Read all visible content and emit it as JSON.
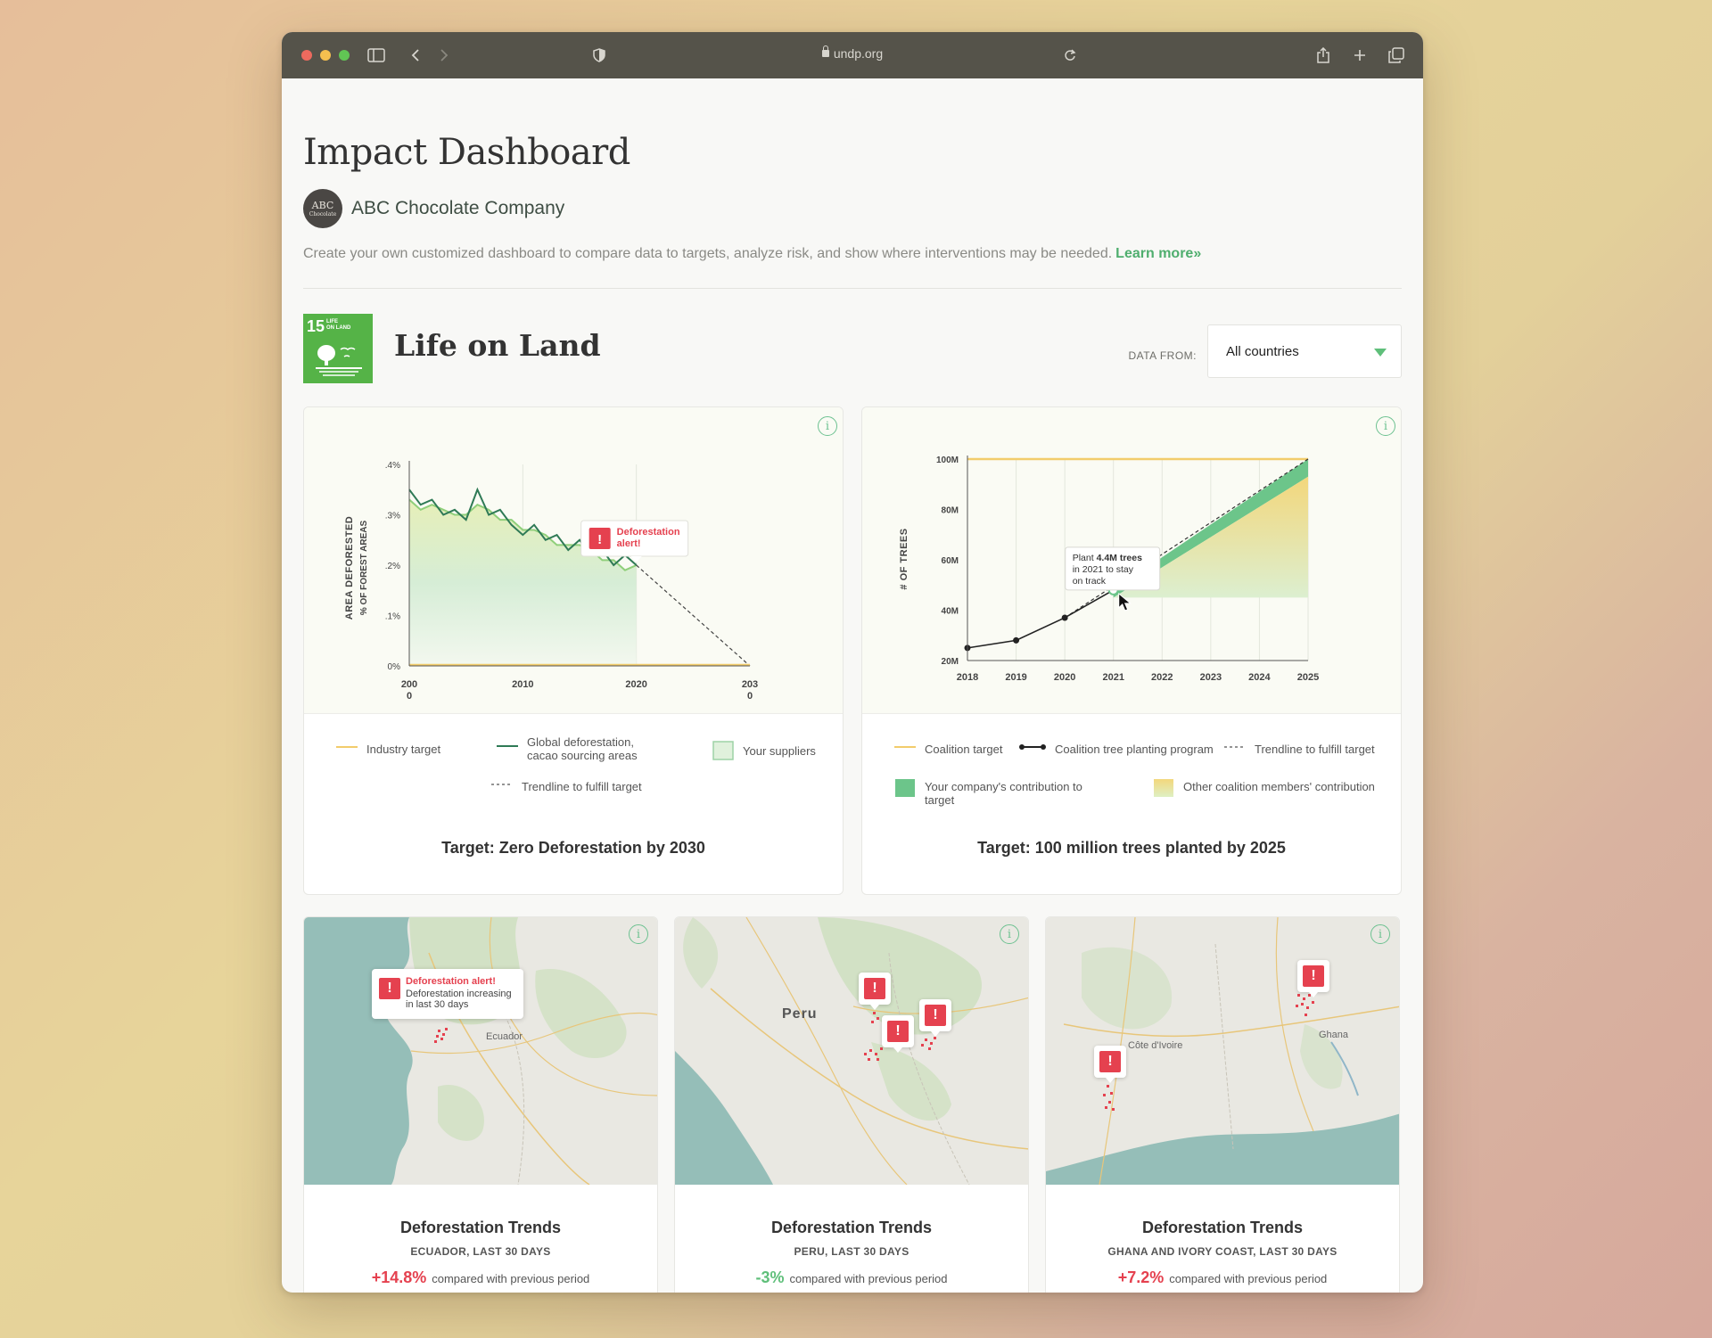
{
  "browser": {
    "url": "undp.org"
  },
  "header": {
    "title": "Impact Dashboard",
    "company_logo_line1": "ABC",
    "company_logo_line2": "Chocolate",
    "company_name": "ABC Chocolate Company",
    "description": "Create your own customized dashboard to compare data to targets, analyze risk, and show where interventions may be needed.",
    "learn_more": "Learn more»"
  },
  "section": {
    "sdg_number": "15",
    "sdg_label_line1": "LIFE",
    "sdg_label_line2": "ON LAND",
    "title": "Life on Land",
    "data_from_label": "DATA FROM:",
    "data_from_value": "All countries"
  },
  "colors": {
    "accent_green": "#4fae6e",
    "alert_red": "#e5414f",
    "target_yellow": "#f2cc6b",
    "dark_green": "#2f7a56",
    "light_green": "#8fcf7a"
  },
  "chart1": {
    "target": "Target: Zero Deforestation by 2030",
    "ylabel_line1": "AREA DEFORESTED",
    "ylabel_line2": "% OF FOREST AREAS",
    "alert_line1": "Deforestation",
    "alert_line2": "alert!",
    "tick_2000_a": "200",
    "tick_2000_b": "0",
    "tick_2030_a": "203",
    "tick_2030_b": "0",
    "legend": {
      "industry": "Industry target",
      "global_line1": "Global deforestation,",
      "global_line2": "cacao sourcing areas",
      "suppliers": "Your suppliers",
      "trendline": "Trendline to fulfill target"
    }
  },
  "chart2": {
    "target": "Target: 100 million trees planted by 2025",
    "ylabel": "# OF TREES",
    "tooltip_pre": "Plant ",
    "tooltip_bold": "4.4M trees",
    "tooltip_line2": "in 2021 to stay",
    "tooltip_line3": "on track",
    "legend": {
      "coalition_target": "Coalition target",
      "program": "Coalition tree planting program",
      "trendline": "Trendline to fulfill target",
      "company_line1": "Your company's contribution to",
      "company_line2": "target",
      "others": "Other coalition members' contribution"
    }
  },
  "chart_data": [
    {
      "type": "line",
      "title": "",
      "ylabel": "AREA DEFORESTED % OF FOREST AREAS",
      "x_range": [
        2000,
        2030
      ],
      "ylim": [
        0,
        0.4
      ],
      "yticks": [
        ".4%",
        ".3%",
        ".2%",
        ".1%",
        "0%"
      ],
      "xticks": [
        "2010",
        "2020"
      ],
      "series": [
        {
          "name": "Global deforestation, cacao sourcing areas",
          "x": [
            2000,
            2001,
            2002,
            2003,
            2004,
            2005,
            2006,
            2007,
            2008,
            2009,
            2010,
            2011,
            2012,
            2013,
            2014,
            2015,
            2016,
            2017,
            2018,
            2019,
            2020
          ],
          "values": [
            0.35,
            0.32,
            0.33,
            0.3,
            0.31,
            0.29,
            0.35,
            0.3,
            0.31,
            0.28,
            0.26,
            0.28,
            0.25,
            0.26,
            0.23,
            0.25,
            0.22,
            0.23,
            0.2,
            0.22,
            0.2
          ]
        },
        {
          "name": "Your suppliers",
          "x": [
            2000,
            2001,
            2002,
            2003,
            2004,
            2005,
            2006,
            2007,
            2008,
            2009,
            2010,
            2011,
            2012,
            2013,
            2014,
            2015,
            2016,
            2017,
            2018,
            2019,
            2020
          ],
          "values": [
            0.33,
            0.31,
            0.32,
            0.31,
            0.3,
            0.3,
            0.32,
            0.31,
            0.29,
            0.29,
            0.27,
            0.27,
            0.26,
            0.24,
            0.24,
            0.24,
            0.23,
            0.21,
            0.21,
            0.19,
            0.2
          ]
        },
        {
          "name": "Industry target",
          "x": [
            2000,
            2030
          ],
          "values": [
            0,
            0
          ]
        },
        {
          "name": "Trendline to fulfill target",
          "x": [
            2020,
            2030
          ],
          "values": [
            0.2,
            0
          ]
        }
      ]
    },
    {
      "type": "area",
      "title": "",
      "ylabel": "# OF TREES",
      "ylim": [
        20,
        100
      ],
      "yticks": [
        "100M",
        "80M",
        "60M",
        "40M",
        "20M"
      ],
      "categories": [
        "2018",
        "2019",
        "2020",
        "2021",
        "2022",
        "2023",
        "2024",
        "2025"
      ],
      "series": [
        {
          "name": "Coalition target",
          "x": [
            2018,
            2025
          ],
          "values": [
            100,
            100
          ]
        },
        {
          "name": "Coalition tree planting program",
          "x": [
            2018,
            2019,
            2020,
            2021
          ],
          "values": [
            25,
            28,
            37,
            48
          ]
        },
        {
          "name": "Trendline to fulfill target",
          "x": [
            2020,
            2025
          ],
          "values": [
            37,
            100
          ]
        },
        {
          "name": "Your company's contribution to target",
          "x": [
            2021,
            2025
          ],
          "values": [
            48,
            100
          ]
        },
        {
          "name": "Other coalition members' contribution",
          "x": [
            2021,
            2025
          ],
          "values": [
            45,
            93
          ]
        }
      ]
    }
  ],
  "maps": [
    {
      "title": "Deforestation Trends",
      "subtitle": "ECUADOR, LAST 30 DAYS",
      "percent": "+14.8%",
      "suffix": "compared with previous period",
      "alert_title": "Deforestation alert!",
      "alert_line1": "Deforestation increasing",
      "alert_line2": "in last 30 days",
      "label": "Ecuador"
    },
    {
      "title": "Deforestation Trends",
      "subtitle": "PERU, LAST 30 DAYS",
      "percent": "-3%",
      "suffix": "compared with previous period",
      "label": "Peru"
    },
    {
      "title": "Deforestation Trends",
      "subtitle": "GHANA AND IVORY COAST, LAST 30 DAYS",
      "percent": "+7.2%",
      "suffix": "compared with previous period",
      "label1": "Côte d'Ivoire",
      "label2": "Ghana"
    }
  ]
}
